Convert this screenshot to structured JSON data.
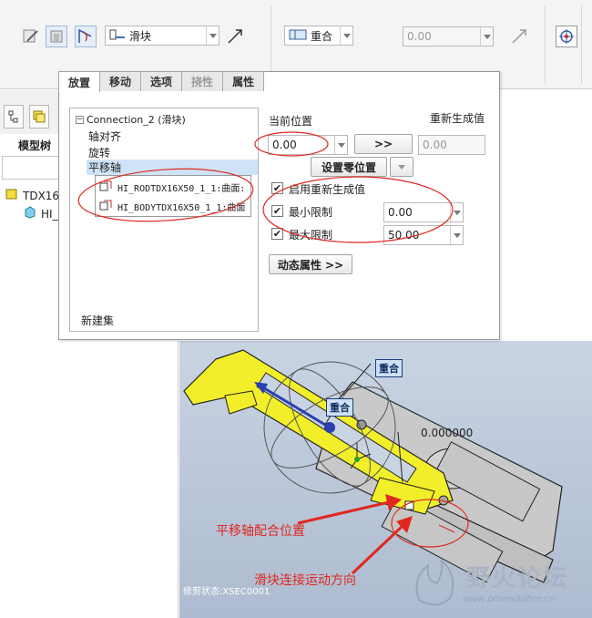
{
  "toolbar": {
    "mode_combo": "滑块",
    "constraint_combo": "重合",
    "offset_combo": "0.00",
    "icons": [
      "sketch-icon",
      "datum-icon",
      "angle-icon",
      "slider-icon",
      "flip-icon",
      "constraint-icon",
      "flip-icon",
      "move-icon"
    ]
  },
  "left_panel": {
    "title": "模型树",
    "tree": [
      {
        "label": "TDX16",
        "icon": "assembly-icon"
      },
      {
        "label": "HI_",
        "icon": "part-icon"
      }
    ]
  },
  "dialog": {
    "tabs": [
      {
        "label": "放置",
        "state": "active"
      },
      {
        "label": "移动",
        "state": "normal"
      },
      {
        "label": "选项",
        "state": "normal"
      },
      {
        "label": "挠性",
        "state": "disabled"
      },
      {
        "label": "属性",
        "state": "normal"
      }
    ],
    "connection": {
      "header": "Connection_2 (滑块)",
      "items": [
        "轴对齐",
        "旋转",
        "平移轴"
      ],
      "selected": "平移轴",
      "refs": [
        "HI_RODTDX16X50_1_1:曲面:",
        "HI_BODYTDX16X50_1_1:曲面"
      ],
      "new_set": "新建集"
    },
    "current_position_label": "当前位置",
    "current_position_value": "0.00",
    "go_button": ">>",
    "regen_label": "重新生成值",
    "regen_value": "0.00",
    "set_zero_button": "设置零位置",
    "enable_regen_label": "启用重新生成值",
    "min_limit_label": "最小限制",
    "min_limit_value": "0.00",
    "max_limit_label": "最大限制",
    "max_limit_value": "50.00",
    "dynamic_button": "动态属性 >>"
  },
  "viewport": {
    "tags": [
      "重合",
      "重合"
    ],
    "dimension": "0.000000",
    "annotation_1": "平移轴配合位置",
    "annotation_2": "滑块连接运动方向",
    "status": "修剪状态:XSEC0001",
    "watermark_title": "野火论坛",
    "watermark_url": "www.proewildfire.cn"
  },
  "colors": {
    "annotation": "#e0281e",
    "part_yellow": "#f2ef2a",
    "selection": "#cfe3f7"
  }
}
